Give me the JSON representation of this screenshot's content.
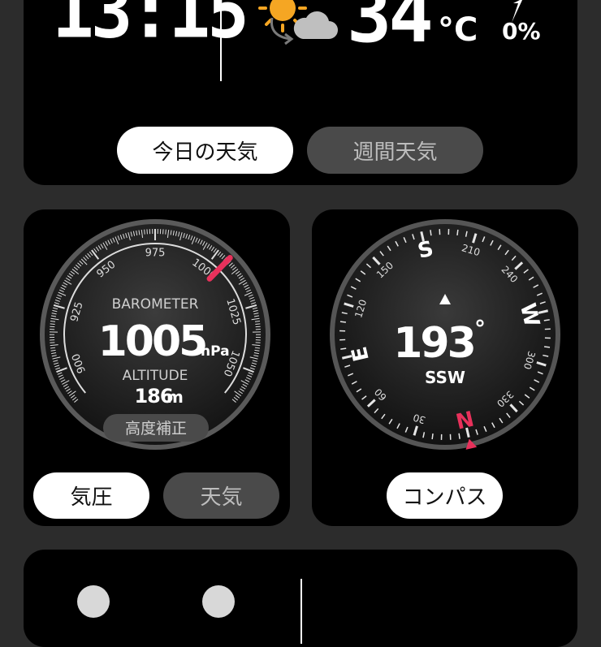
{
  "top": {
    "time": "13:15",
    "temperature": "34",
    "temp_unit": "°C",
    "rain_chance": "0%",
    "weather_icon": "sun-cloud-icon",
    "tabs": [
      {
        "label": "今日の天気",
        "active": true
      },
      {
        "label": "週間天気",
        "active": false
      }
    ]
  },
  "barometer": {
    "title": "BAROMETER",
    "pressure": "1005",
    "pressure_unit": "hPa",
    "altitude_title": "ALTITUDE",
    "altitude": "186",
    "altitude_unit": "m",
    "calibrate_label": "高度補正",
    "scale_labels": [
      "900",
      "925",
      "950",
      "975",
      "1000",
      "1025",
      "1050"
    ],
    "scale_min": 887,
    "scale_max": 1063,
    "needle_value": 1005,
    "accent": "#e8315b",
    "buttons": [
      {
        "label": "気圧",
        "active": true
      },
      {
        "label": "天気",
        "active": false
      }
    ]
  },
  "compass": {
    "heading": "193",
    "degree_symbol": "°",
    "direction": "SSW",
    "cardinals": [
      "N",
      "E",
      "S",
      "W"
    ],
    "bearing_labels": [
      "30",
      "60",
      "120",
      "150",
      "210",
      "240",
      "300",
      "330"
    ],
    "north_color": "#e8315b",
    "button_label": "コンパス"
  },
  "bottom": {
    "icons": [
      "moon-phase-icon",
      "sunrise-icon"
    ]
  }
}
